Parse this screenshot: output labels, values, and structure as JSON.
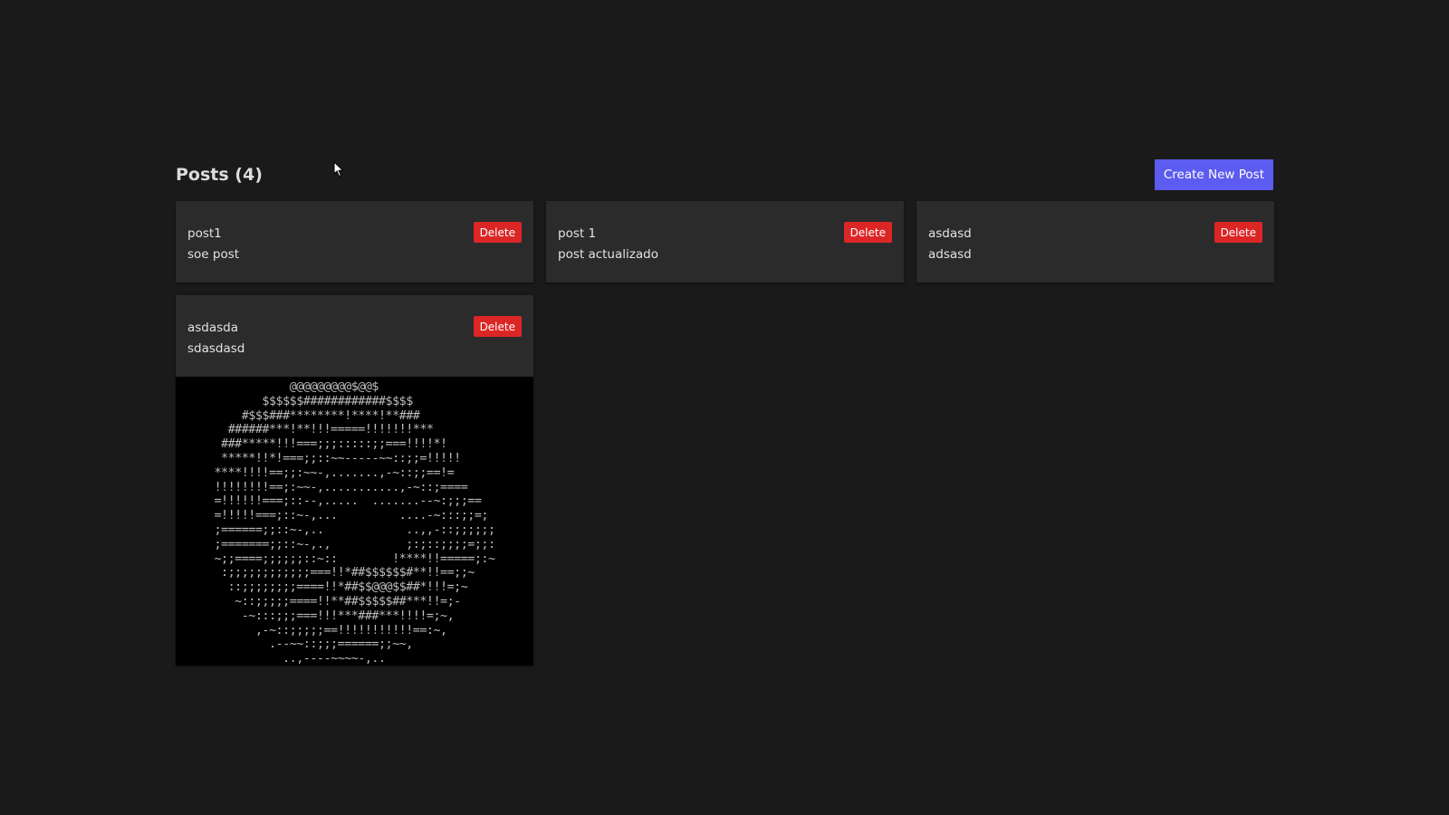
{
  "header": {
    "title": "Posts (4)",
    "create_button_label": "Create New Post"
  },
  "posts": [
    {
      "title": "post1",
      "content": "soe post",
      "delete_label": "Delete"
    },
    {
      "title": "post 1",
      "content": "post actualizado",
      "delete_label": "Delete"
    },
    {
      "title": "asdasd",
      "content": "adsasd",
      "delete_label": "Delete"
    },
    {
      "title": "asdasda",
      "content": "sdasdasd",
      "delete_label": "Delete",
      "image_ascii": "           @@@@@@@@@$@@$\n       $$$$$$############$$$$\n    #$$$###********!****!**###\n  ######***!**!!!=====!!!!!!!***\n ###*****!!!===;;;:::::;;===!!!!*!\n *****!!*!===;;::~~-----~~::;;=!!!!!\n****!!!!==;;:~~-,.......,-~::;;==!=\n!!!!!!!!==;:~~-,...........,-~::;====\n=!!!!!!===;::--,.....  .......--~:;;;==\n=!!!!!===;::~-,...         ....-~:::;;=;\n;======;;::~-,..            ..,,-::;;;;;;\n;=======;;::~-,.,           ;:;::;;;;=;;:\n~;;====;;;;;;::~::        !****!!=====;:~\n :;;;;;;;;;;;;===!!*##$$$$$$#**!!==;;~\n  ::;;;;;;;;====!!*##$$@@@$$##*!!!=;~\n   ~::;;;;;====!!**##$$$$$##***!!=;-\n    -~:::;;;===!!!***###***!!!!=;~,\n      ,-~::;;;;;==!!!!!!!!!!!==:~,\n        .--~~::;;;======;;~~,\n          ..,----~~~~-,.."
    }
  ],
  "colors": {
    "background": "#1a1a1b",
    "card": "#2b2b2c",
    "accent": "#5c5cf0",
    "danger": "#dc2626"
  },
  "icons": {
    "cursor": "mouse-pointer-icon"
  }
}
